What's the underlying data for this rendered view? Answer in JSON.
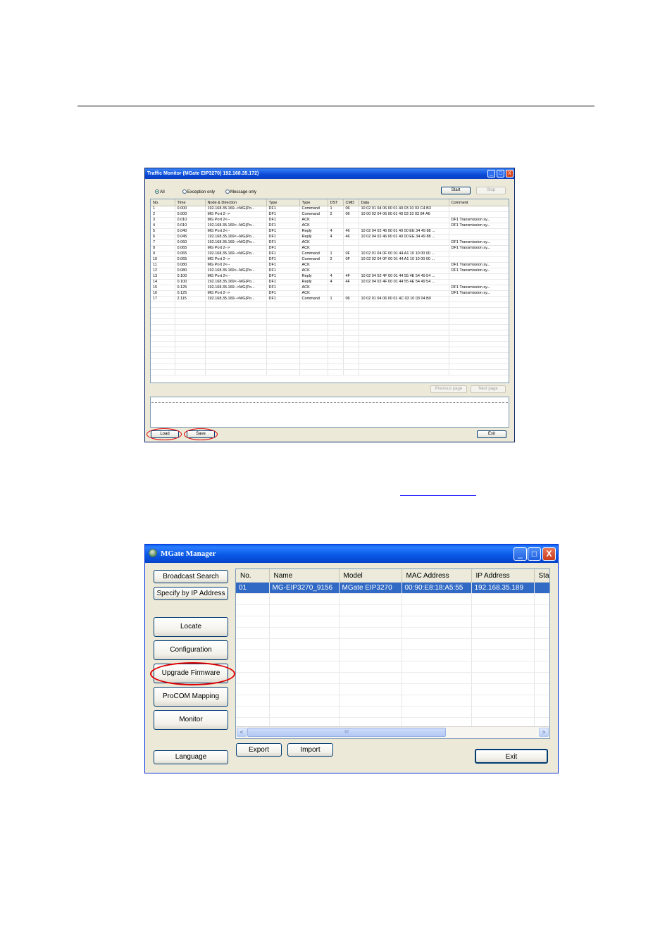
{
  "traffic_monitor": {
    "title": "Traffic Monitor (MGate EIP3270) 192.168.35.172)",
    "window_controls": {
      "minimize": "_",
      "maximize": "□",
      "close": "X"
    },
    "filters": [
      {
        "label": "All",
        "selected": true
      },
      {
        "label": "Exception only",
        "selected": false
      },
      {
        "label": "Message only",
        "selected": false
      }
    ],
    "start_label": "Start",
    "stop_label": "Stop",
    "columns": [
      "No.",
      "Time",
      "Node & Direction",
      "Type",
      "Type",
      "DST",
      "CMD",
      "Data",
      "Comment"
    ],
    "rows": [
      [
        "1",
        "0.000",
        "192.168.35.169-->MG(Po...",
        "DF1",
        "Command",
        "1",
        "06",
        "10 02 01 04 06 00 01 40 03 10 03 C4 B3",
        ""
      ],
      [
        "2",
        "0.000",
        "MG Port 2-->",
        "DF1",
        "Command",
        "2",
        "06",
        "10 00 02 04 06 00 01 40 03 10 03 84 A6",
        ""
      ],
      [
        "3",
        "0.010",
        "MG Port 2<--",
        "DF1",
        "ACK",
        "",
        "",
        "",
        "DF1 Transmission sy..."
      ],
      [
        "4",
        "0.010",
        "192.168.35.169<--MG(Po...",
        "DF1",
        "ACK",
        "",
        "",
        "",
        "DF1 Transmission sy..."
      ],
      [
        "5",
        "0.040",
        "MG Port 2<--",
        "DF1",
        "Reply",
        "4",
        "46",
        "10 02 04 02 46 00 01 40 00 EE 34 49 88 ...",
        ""
      ],
      [
        "6",
        "0.045",
        "192.168.35.169<--MG(Po...",
        "DF1",
        "Reply",
        "4",
        "46",
        "10 02 04 02 46 00 01 40 00 EE 34 49 88 ...",
        ""
      ],
      [
        "7",
        "0.060",
        "192.168.35.169-->MG(Po...",
        "DF1",
        "ACK",
        "",
        "",
        "",
        "DF1 Transmission sy..."
      ],
      [
        "8",
        "0.065",
        "MG Port 2-->",
        "DF1",
        "ACK",
        "",
        "",
        "",
        "DF1 Transmission sy..."
      ],
      [
        "9",
        "0.065",
        "192.168.35.169-->MG(Po...",
        "DF1",
        "Command",
        "1",
        "0F",
        "10 02 01 04 0F 00 01 44 A1 10 10 00 00 ...",
        ""
      ],
      [
        "10",
        "0.065",
        "MG Port 2-->",
        "DF1",
        "Command",
        "2",
        "0F",
        "10 02 02 04 0F 00 01 44 A1 10 10 00 00 ...",
        ""
      ],
      [
        "11",
        "0.080",
        "MG Port 2<--",
        "DF1",
        "ACK",
        "",
        "",
        "",
        "DF1 Transmission sy..."
      ],
      [
        "12",
        "0.080",
        "192.168.35.169<--MG(Po...",
        "DF1",
        "ACK",
        "",
        "",
        "",
        "DF1 Transmission sy..."
      ],
      [
        "13",
        "0.100",
        "MG Port 2<--",
        "DF1",
        "Reply",
        "4",
        "4F",
        "10 02 04 02 4F 00 01 44 55 4E 54 49 54 ...",
        ""
      ],
      [
        "14",
        "0.100",
        "192.168.35.169<--MG(Po...",
        "DF1",
        "Reply",
        "4",
        "4F",
        "10 02 04 02 4F 00 01 44 55 4E 54 49 54 ...",
        ""
      ],
      [
        "15",
        "0.125",
        "192.168.35.169-->MG(Po...",
        "DF1",
        "ACK",
        "",
        "",
        "",
        "DF1 Transmission sy..."
      ],
      [
        "16",
        "0.125",
        "MG Port 2-->",
        "DF1",
        "ACK",
        "",
        "",
        "",
        "DF1 Transmission sy..."
      ],
      [
        "17",
        "2.115",
        "192.168.35.169-->MG(Po...",
        "DF1",
        "Command",
        "1",
        "06",
        "10 02 01 04 06 00 01 4C 03 10 03 04 B0",
        ""
      ]
    ],
    "prev_page_label": "Previous page",
    "next_page_label": "Next page",
    "load_label": "Load",
    "save_label": "Save",
    "exit_label": "Exit"
  },
  "mgate_manager": {
    "title": "MGate Manager",
    "window_controls": {
      "minimize": "_",
      "maximize": "□",
      "close": "X"
    },
    "buttons": {
      "broadcast_search": "Broadcast Search",
      "specify_by_ip": "Specify by IP Address",
      "locate": "Locate",
      "configuration": "Configuration",
      "upgrade_firmware": "Upgrade Firmware",
      "procom_mapping": "ProCOM Mapping",
      "monitor": "Monitor",
      "language": "Language",
      "export": "Export",
      "import": "Import",
      "exit": "Exit"
    },
    "columns": [
      "No.",
      "Name",
      "Model",
      "MAC Address",
      "IP Address",
      "Sta"
    ],
    "devices": [
      {
        "no": "01",
        "name": "MG-EIP3270_9156",
        "model": "MGate EIP3270",
        "mac": "00:90:E8:18:A5:55",
        "ip": "192.168.35.189",
        "status": ""
      }
    ],
    "scrollbar": {
      "left_arrow": "<",
      "right_arrow": ">",
      "thumb_grip": "III"
    }
  }
}
